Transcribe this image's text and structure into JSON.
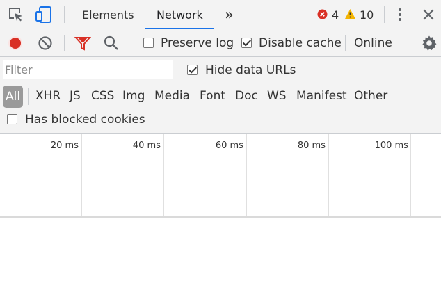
{
  "toolbar": {
    "tabs": [
      {
        "label": "Elements"
      },
      {
        "label": "Network"
      }
    ],
    "more_tabs_label": "»",
    "error_count": "4",
    "warning_count": "10"
  },
  "network_toolbar": {
    "preserve_log_label": "Preserve log",
    "preserve_log_checked": false,
    "disable_cache_label": "Disable cache",
    "disable_cache_checked": true,
    "throttle_label": "Online"
  },
  "filter_bar": {
    "placeholder": "Filter",
    "value": "",
    "hide_data_urls_label": "Hide data URLs",
    "hide_data_urls_checked": true,
    "types": [
      "All",
      "XHR",
      "JS",
      "CSS",
      "Img",
      "Media",
      "Font",
      "Doc",
      "WS",
      "Manifest",
      "Other"
    ],
    "selected_type": "All",
    "blocked_cookies_label": "Has blocked cookies",
    "blocked_cookies_checked": false
  },
  "timeline": {
    "ticks": [
      "20 ms",
      "40 ms",
      "60 ms",
      "80 ms",
      "100 ms"
    ]
  },
  "colors": {
    "record": "#d93025",
    "error": "#d93025",
    "warning": "#f4b400",
    "filter_active": "#d93025",
    "tab_underline": "#1a73e8"
  }
}
